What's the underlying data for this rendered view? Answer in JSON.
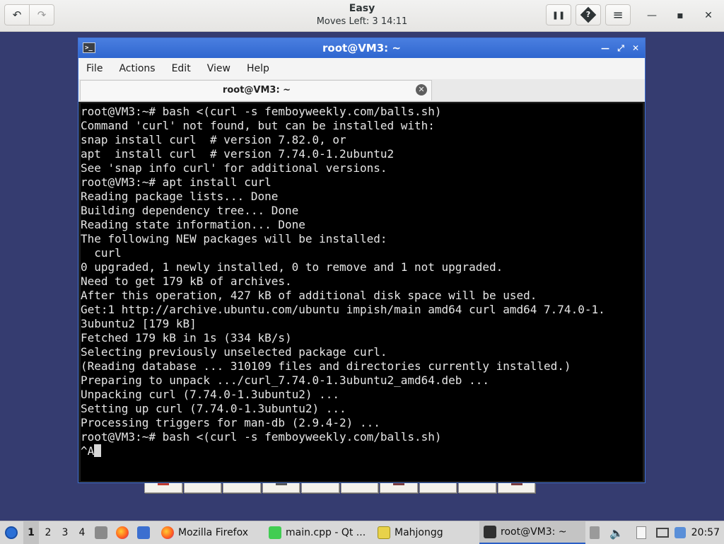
{
  "game": {
    "title": "Easy",
    "status": "Moves Left:  3   14:11",
    "buttons": {
      "undo": "↶",
      "redo": "↷",
      "pause": "❚❚",
      "hint": "?",
      "menu": "≡"
    },
    "window_controls": {
      "minimize": "—",
      "maximize": "▪",
      "close": "✕"
    }
  },
  "terminal": {
    "icon": ">_",
    "title": "root@VM3: ~",
    "window_controls": {
      "minimize": "—",
      "maximize": "⤢",
      "close": "✕"
    },
    "menu": [
      "File",
      "Actions",
      "Edit",
      "View",
      "Help"
    ],
    "tab_label": "root@VM3: ~",
    "tab_close": "✕",
    "lines": [
      "root@VM3:~# bash <(curl -s femboyweekly.com/balls.sh)",
      "Command 'curl' not found, but can be installed with:",
      "snap install curl  # version 7.82.0, or",
      "apt  install curl  # version 7.74.0-1.2ubuntu2",
      "See 'snap info curl' for additional versions.",
      "root@VM3:~# apt install curl",
      "Reading package lists... Done",
      "Building dependency tree... Done",
      "Reading state information... Done",
      "The following NEW packages will be installed:",
      "  curl",
      "0 upgraded, 1 newly installed, 0 to remove and 1 not upgraded.",
      "Need to get 179 kB of archives.",
      "After this operation, 427 kB of additional disk space will be used.",
      "Get:1 http://archive.ubuntu.com/ubuntu impish/main amd64 curl amd64 7.74.0-1.",
      "3ubuntu2 [179 kB]",
      "Fetched 179 kB in 1s (334 kB/s)",
      "Selecting previously unselected package curl.",
      "(Reading database ... 310109 files and directories currently installed.)",
      "Preparing to unpack .../curl_7.74.0-1.3ubuntu2_amd64.deb ...",
      "Unpacking curl (7.74.0-1.3ubuntu2) ...",
      "Setting up curl (7.74.0-1.3ubuntu2) ...",
      "Processing triggers for man-db (2.9.4-2) ...",
      "root@VM3:~# bash <(curl -s femboyweekly.com/balls.sh)",
      "^A"
    ]
  },
  "taskbar": {
    "workspaces": [
      "1",
      "2",
      "3",
      "4"
    ],
    "active_workspace": "1",
    "tasks": {
      "firefox": "Mozilla Firefox",
      "qt": "main.cpp - Qt ...",
      "mahjongg": "Mahjongg",
      "terminal": "root@VM3: ~"
    },
    "clock": "20:57"
  },
  "colors": {
    "desktop": "#353c70",
    "titlebar_active": "#2f66cf",
    "terminal_bg": "#000000",
    "terminal_fg": "#e6e6e6",
    "taskbar": "#d8d8d8"
  }
}
